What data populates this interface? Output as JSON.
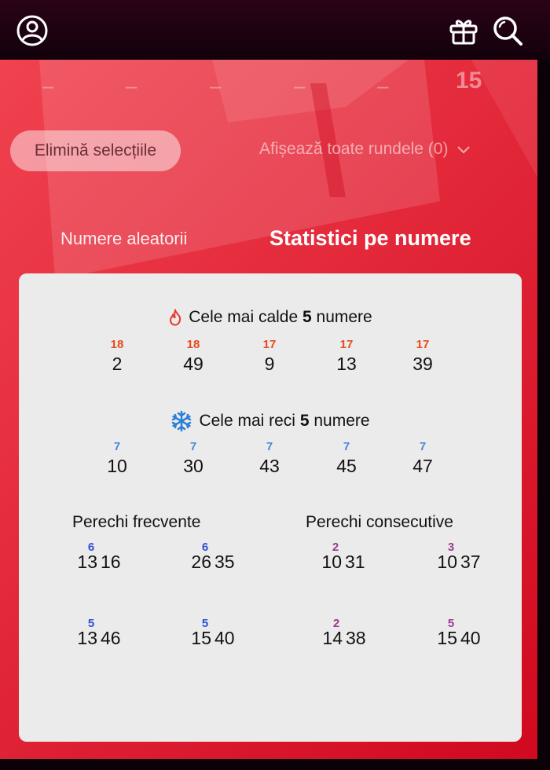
{
  "colors": {
    "hot": "#e84a1a",
    "cold": "#4a88d8",
    "pair_frequent": "#2f4fd8",
    "pair_consecutive": "#9b3b8f",
    "background": "#e3283a"
  },
  "header": {
    "icons": [
      "user-icon",
      "gift-icon",
      "search-icon"
    ]
  },
  "balls": {
    "placeholders": [
      "–",
      "–",
      "–",
      "–",
      "–"
    ],
    "count": "15"
  },
  "controls": {
    "clear_label": "Elimină selecțiile",
    "rounds_label": "Afișează toate rundele (0)"
  },
  "tabs": {
    "random": "Numere aleatorii",
    "stats": "Statistici pe numere"
  },
  "hot": {
    "title_prefix": "Cele mai calde",
    "title_count": "5",
    "title_suffix": "numere",
    "items": [
      {
        "freq": "18",
        "num": "2"
      },
      {
        "freq": "18",
        "num": "49"
      },
      {
        "freq": "17",
        "num": "9"
      },
      {
        "freq": "17",
        "num": "13"
      },
      {
        "freq": "17",
        "num": "39"
      }
    ]
  },
  "cold": {
    "title_prefix": "Cele mai reci",
    "title_count": "5",
    "title_suffix": "numere",
    "items": [
      {
        "freq": "7",
        "num": "10"
      },
      {
        "freq": "7",
        "num": "30"
      },
      {
        "freq": "7",
        "num": "43"
      },
      {
        "freq": "7",
        "num": "45"
      },
      {
        "freq": "7",
        "num": "47"
      }
    ]
  },
  "frequent_pairs": {
    "title": "Perechi frecvente",
    "items": [
      {
        "a": "13",
        "b": "16",
        "count": "6"
      },
      {
        "a": "26",
        "b": "35",
        "count": "6"
      },
      {
        "a": "13",
        "b": "46",
        "count": "5"
      },
      {
        "a": "15",
        "b": "40",
        "count": "5"
      }
    ]
  },
  "consecutive_pairs": {
    "title": "Perechi consecutive",
    "items": [
      {
        "a": "10",
        "b": "31",
        "count": "2"
      },
      {
        "a": "10",
        "b": "37",
        "count": "3"
      },
      {
        "a": "14",
        "b": "38",
        "count": "2"
      },
      {
        "a": "15",
        "b": "40",
        "count": "5"
      }
    ]
  }
}
